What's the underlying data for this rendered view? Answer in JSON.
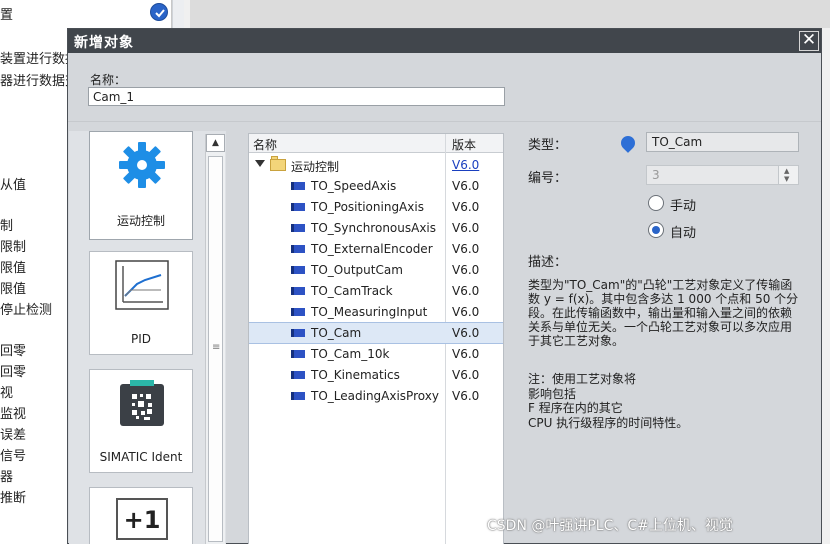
{
  "background": {
    "left_items": [
      "置",
      "装置进行数据",
      "器进行数据交",
      "从值",
      "制",
      "限制",
      "限值",
      "限值",
      "停止检测",
      "回零",
      "回零",
      "视",
      "监视",
      "误差",
      "信号",
      "器",
      "推断"
    ]
  },
  "dialog": {
    "title": "新增对象",
    "close_symbol": "✕",
    "name_label": "名称：",
    "name_value": "Cam_1",
    "categories": [
      {
        "label": "运动控制",
        "icon": "gear-icon",
        "selected": true
      },
      {
        "label": "PID",
        "icon": "pid-chart-icon",
        "selected": false
      },
      {
        "label": "SIMATIC Ident",
        "icon": "ident-reader-icon",
        "selected": false
      },
      {
        "label": "",
        "glyph": "+1",
        "icon": "counter-icon",
        "selected": false
      }
    ],
    "tree": {
      "col_name": "名称",
      "col_version": "版本",
      "folder": {
        "name": "运动控制",
        "version": "V6.0"
      },
      "items": [
        {
          "name": "TO_SpeedAxis",
          "version": "V6.0"
        },
        {
          "name": "TO_PositioningAxis",
          "version": "V6.0"
        },
        {
          "name": "TO_SynchronousAxis",
          "version": "V6.0"
        },
        {
          "name": "TO_ExternalEncoder",
          "version": "V6.0"
        },
        {
          "name": "TO_OutputCam",
          "version": "V6.0"
        },
        {
          "name": "TO_CamTrack",
          "version": "V6.0"
        },
        {
          "name": "TO_MeasuringInput",
          "version": "V6.0"
        },
        {
          "name": "TO_Cam",
          "version": "V6.0",
          "selected": true
        },
        {
          "name": "TO_Cam_10k",
          "version": "V6.0"
        },
        {
          "name": "TO_Kinematics",
          "version": "V6.0"
        },
        {
          "name": "TO_LeadingAxisProxy",
          "version": "V6.0"
        }
      ]
    },
    "props": {
      "type_label": "类型：",
      "type_value": "TO_Cam",
      "number_label": "编号：",
      "number_value": "3",
      "radio_manual": "手动",
      "radio_auto": "自动",
      "radio_selected": "自动",
      "desc_label": "描述：",
      "desc_text": "类型为\"TO_Cam\"的\"凸轮\"工艺对象定义了传输函数 y = f(x)。其中包含多达 1 000 个点和 50 个分段。在此传输函数中，输出量和输入量之间的依赖关系与单位无关。一个凸轮工艺对象可以多次应用于其它工艺对象。",
      "note_text": "注：使用工艺对象将\n影响包括\nF 程序在内的其它\nCPU 执行级程序的时间特性。"
    }
  },
  "watermark": "CSDN @叶强讲PLC、C#上位机、视觉",
  "colors": {
    "accent": "#2a64c8",
    "titlebar": "#41464c",
    "link": "#1a3fbf"
  }
}
